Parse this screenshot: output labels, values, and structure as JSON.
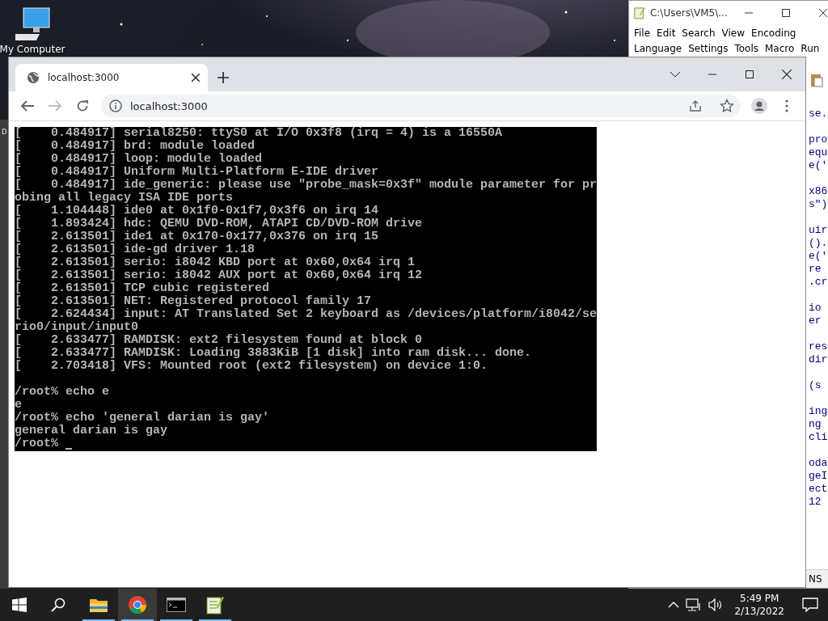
{
  "desktop": {
    "icons": [
      {
        "label": "My Computer"
      }
    ],
    "behind_fragment": "D"
  },
  "notepad_window": {
    "title": "C:\\Users\\VM5\\...",
    "menu_rows": [
      [
        "File",
        "Edit",
        "Search",
        "View",
        "Encoding"
      ],
      [
        "Language",
        "Settings",
        "Tools",
        "Macro",
        "Run"
      ]
    ],
    "code_blocks": [
      [
        "se."
      ],
      [
        "pro",
        "equ",
        "e('"
      ],
      [
        "x86",
        "s\")"
      ],
      [
        "uir",
        "().",
        "e('",
        "re",
        ".cr"
      ],
      [
        "io",
        "er"
      ],
      [
        "res",
        "dir"
      ],
      [
        "(s"
      ],
      [
        "ing",
        "ng",
        "cli"
      ],
      [
        "oda",
        "geI",
        "ect",
        "12"
      ]
    ],
    "status_fragment": "NS"
  },
  "browser": {
    "tabs": [
      {
        "title": "localhost:3000",
        "selected": true
      }
    ],
    "address": "localhost:3000",
    "forward_disabled": true,
    "terminal": {
      "boot_log": [
        "[    0.484917] serial8250: ttyS0 at I/O 0x3f8 (irq = 4) is a 16550A",
        "[    0.484917] brd: module loaded",
        "[    0.484917] loop: module loaded",
        "[    0.484917] Uniform Multi-Platform E-IDE driver",
        "[    0.484917] ide_generic: please use \"probe_mask=0x3f\" module parameter for pr",
        "obing all legacy ISA IDE ports",
        "[    1.104448] ide0 at 0x1f0-0x1f7,0x3f6 on irq 14",
        "[    1.893424] hdc: QEMU DVD-ROM, ATAPI CD/DVD-ROM drive",
        "[    2.613501] ide1 at 0x170-0x177,0x376 on irq 15",
        "[    2.613501] ide-gd driver 1.18",
        "[    2.613501] serio: i8042 KBD port at 0x60,0x64 irq 1",
        "[    2.613501] serio: i8042 AUX port at 0x60,0x64 irq 12",
        "[    2.613501] TCP cubic registered",
        "[    2.613501] NET: Registered protocol family 17",
        "[    2.624434] input: AT Translated Set 2 keyboard as /devices/platform/i8042/se",
        "rio0/input/input0",
        "[    2.633477] RAMDISK: ext2 filesystem found at block 0",
        "[    2.633477] RAMDISK: Loading 3883KiB [1 disk] into ram disk... done.",
        "[    2.703418] VFS: Mounted root (ext2 filesystem) on device 1:0."
      ],
      "session": [
        "/root% echo e",
        "e",
        "/root% echo 'general darian is gay'",
        "general darian is gay"
      ],
      "prompt": "/root%"
    }
  },
  "taskbar": {
    "apps": [
      {
        "kind": "explorer",
        "running": true,
        "selected": false
      },
      {
        "kind": "chrome",
        "running": true,
        "selected": true
      },
      {
        "kind": "console",
        "running": true,
        "selected": false
      },
      {
        "kind": "notepad",
        "running": true,
        "selected": false
      }
    ],
    "time": "5:49 PM",
    "date": "2/13/2022"
  }
}
